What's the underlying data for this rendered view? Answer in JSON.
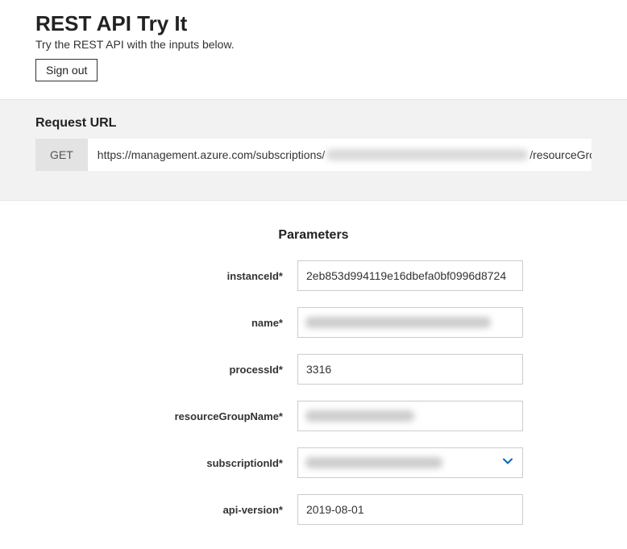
{
  "header": {
    "title": "REST API Try It",
    "subtitle": "Try the REST API with the inputs below.",
    "signout": "Sign out"
  },
  "request": {
    "heading": "Request URL",
    "method": "GET",
    "url_prefix": "https://management.azure.com/subscriptions/",
    "url_suffix": "/resourceGrou"
  },
  "parameters": {
    "heading": "Parameters",
    "rows": [
      {
        "label": "instanceId*",
        "value": "2eb853d994119e16dbefa0bf0996d8724",
        "blurred": false,
        "dropdown": false
      },
      {
        "label": "name*",
        "value": "",
        "blurred": true,
        "dropdown": false,
        "blurWidth": 230
      },
      {
        "label": "processId*",
        "value": "3316",
        "blurred": false,
        "dropdown": false
      },
      {
        "label": "resourceGroupName*",
        "value": "",
        "blurred": true,
        "dropdown": false,
        "blurWidth": 135
      },
      {
        "label": "subscriptionId*",
        "value": "",
        "blurred": true,
        "dropdown": true,
        "blurWidth": 170
      },
      {
        "label": "api-version*",
        "value": "2019-08-01",
        "blurred": false,
        "dropdown": false
      }
    ]
  }
}
